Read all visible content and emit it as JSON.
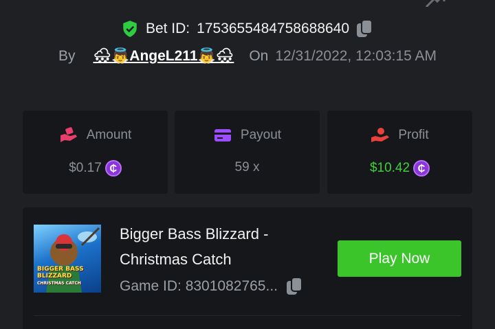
{
  "bet": {
    "id_label": "Bet ID:",
    "id_value": "1753655484758688640"
  },
  "author": {
    "by_label": "By",
    "username": "🌨👼AngeL211👼🌨",
    "on_label": "On",
    "datetime": "12/31/2022, 12:03:15 AM"
  },
  "stats": {
    "amount": {
      "label": "Amount",
      "value": "$0.17",
      "icon": "hand-coins-icon"
    },
    "payout": {
      "label": "Payout",
      "value": "59 x",
      "icon": "wallet-icon"
    },
    "profit": {
      "label": "Profit",
      "value": "$10.42",
      "icon": "profit-hand-icon"
    }
  },
  "currency_symbol": "₵",
  "game": {
    "title": "Bigger Bass Blizzard - Christmas Catch",
    "id_text": "Game ID: 8301082765...",
    "thumbnail_lines": [
      "BIGGER BASS",
      "BLIZZARD",
      "CHRISTMAS CATCH"
    ],
    "play_label": "Play Now"
  },
  "colors": {
    "background": "#1f2024",
    "card": "#16171a",
    "accent_green": "#3cc42b",
    "profit_green": "#3fcf3c",
    "coin_purple": "#8a34d9",
    "shield_green": "#2ecc40",
    "amount_icon": "#e83e6b",
    "payout_icon": "#9b4dff",
    "profit_icon": "#e8423b"
  }
}
